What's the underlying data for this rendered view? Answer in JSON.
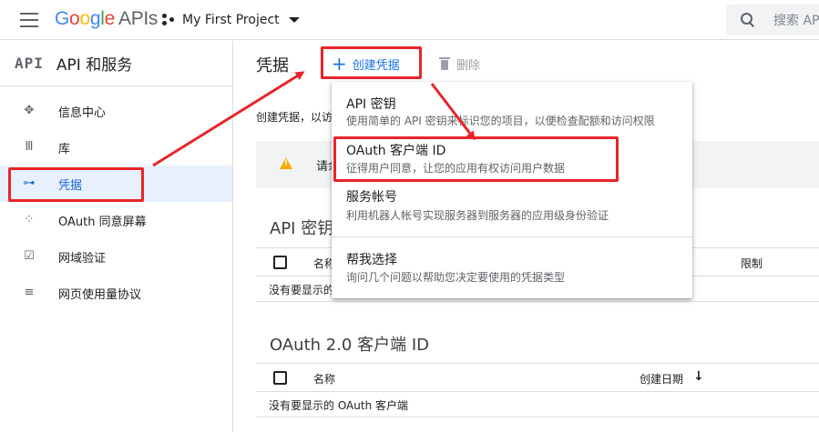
{
  "header": {
    "logo_letters": [
      "G",
      "o",
      "o",
      "g",
      "l",
      "e"
    ],
    "logo_suffix": "APIs",
    "project_name": "My First Project",
    "search_placeholder": "搜索 AP"
  },
  "sidebar": {
    "api_badge": "API",
    "title": "API 和服务",
    "items": [
      {
        "label": "信息中心",
        "icon": "dashboard-icon",
        "active": false
      },
      {
        "label": "库",
        "icon": "library-icon",
        "active": false
      },
      {
        "label": "凭据",
        "icon": "key-icon",
        "active": true
      },
      {
        "label": "OAuth 同意屏幕",
        "icon": "oauth-consent-icon",
        "active": false
      },
      {
        "label": "网域验证",
        "icon": "domain-verify-icon",
        "active": false
      },
      {
        "label": "网页使用量协议",
        "icon": "usage-agreement-icon",
        "active": false
      }
    ]
  },
  "toolbar": {
    "page_title": "凭据",
    "create_label": "创建凭据",
    "delete_label": "删除"
  },
  "main": {
    "intro": "创建凭据，以访",
    "warning": "请余"
  },
  "api_keys": {
    "title": "API 密钥",
    "col_name": "名称",
    "col_limit": "限制",
    "empty": "没有要显示的"
  },
  "oauth": {
    "title": "OAuth 2.0 客户端 ID",
    "col_name": "名称",
    "col_date": "创建日期",
    "sort_icon": "↓",
    "empty": "没有要显示的 OAuth 客户端"
  },
  "menu": {
    "items": [
      {
        "title": "API 密钥",
        "desc": "使用简单的 API 密钥来标识您的项目，以便检查配额和访问权限"
      },
      {
        "title": "OAuth 客户端 ID",
        "desc": "征得用户同意，让您的应用有权访问用户数据"
      },
      {
        "title": "服务帐号",
        "desc": "利用机器人帐号实现服务器到服务器的应用级身份验证"
      },
      {
        "title": "帮我选择",
        "desc": "询问几个问题以帮助您决定要使用的凭据类型"
      }
    ]
  },
  "colors": {
    "accent": "#1a73e8",
    "annotation_red": "#e8242a",
    "warning": "#f9ab00"
  }
}
